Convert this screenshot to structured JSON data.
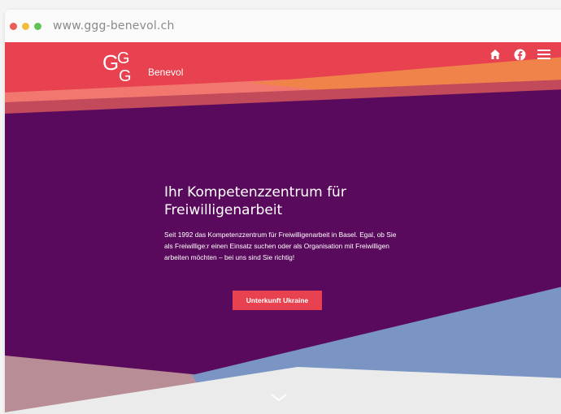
{
  "browser": {
    "url": "www.ggg-benevol.ch",
    "traffic_lights": [
      "#ec5d57",
      "#f3be3f",
      "#5fc454"
    ]
  },
  "header": {
    "logo_text": "GGG",
    "brand_name": "Benevol",
    "icons": [
      "home-icon",
      "facebook-icon",
      "menu-icon"
    ]
  },
  "hero": {
    "title": "Ihr Kompetenzzentrum für Freiwilligenarbeit",
    "text": "Seit 1992 das Kompetenzzentrum für Freiwilligenarbeit in Basel. Egal, ob Sie als Freiwillige:r einen Einsatz suchen oder als Organisation mit Freiwilligen arbeiten möchten – bei uns sind Sie richtig!",
    "cta_label": "Unterkunft Ukraine"
  },
  "colors": {
    "red": "#e8414f",
    "purple": "#5a0a5c",
    "orange": "#f0834a",
    "blue": "#7a94c4",
    "mauve": "#b98d96",
    "light_gray": "#ebebeb"
  },
  "scroll_hint": "chevron-down-icon"
}
